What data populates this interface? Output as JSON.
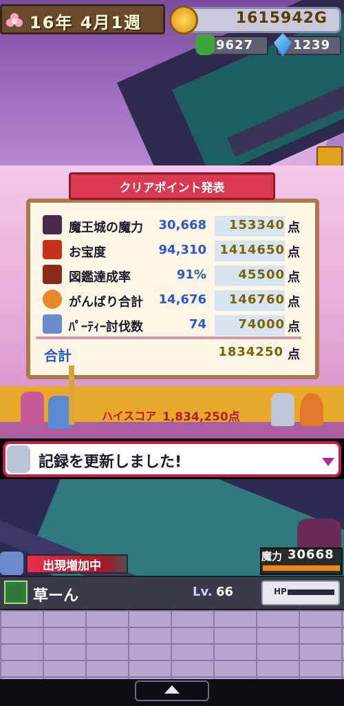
{
  "hud": {
    "date": "16年 4月1週",
    "gold": "1615942G",
    "demons": "9627",
    "crystals": "1239"
  },
  "result": {
    "title": "クリアポイント発表",
    "rows": [
      {
        "label": "魔王城の魔力",
        "value": "30,668",
        "points": "153340",
        "unit": "点",
        "icon": "demon-lord-icon"
      },
      {
        "label": "お宝度",
        "value": "94,310",
        "points": "1414650",
        "unit": "点",
        "icon": "treasure-chest-icon"
      },
      {
        "label": "図鑑達成率",
        "value": "91%",
        "points": "45500",
        "unit": "点",
        "icon": "book-icon"
      },
      {
        "label": "がんばり合計",
        "value": "14,676",
        "points": "146760",
        "unit": "点",
        "icon": "effort-icon"
      },
      {
        "label": "ﾊﾟｰﾃｨｰ討伐数",
        "value": "74",
        "points": "74000",
        "unit": "点",
        "icon": "party-knight-icon"
      }
    ],
    "total_label": "合計",
    "total_points": "1834250",
    "total_unit": "点"
  },
  "highscore": {
    "label": "ハイスコア",
    "value": "1,834,250点"
  },
  "message": {
    "text": "記録を更新しました!"
  },
  "battle": {
    "spawn_label": "出現増加中",
    "mana_label": "魔力",
    "mana_value": "30668"
  },
  "status": {
    "name": "草ーん",
    "level_label": "Lv.",
    "level": "66",
    "hp_label": "HP"
  },
  "colors": {
    "accent": "#d93a52",
    "points": "#7a6400",
    "values": "#2b57c8"
  }
}
